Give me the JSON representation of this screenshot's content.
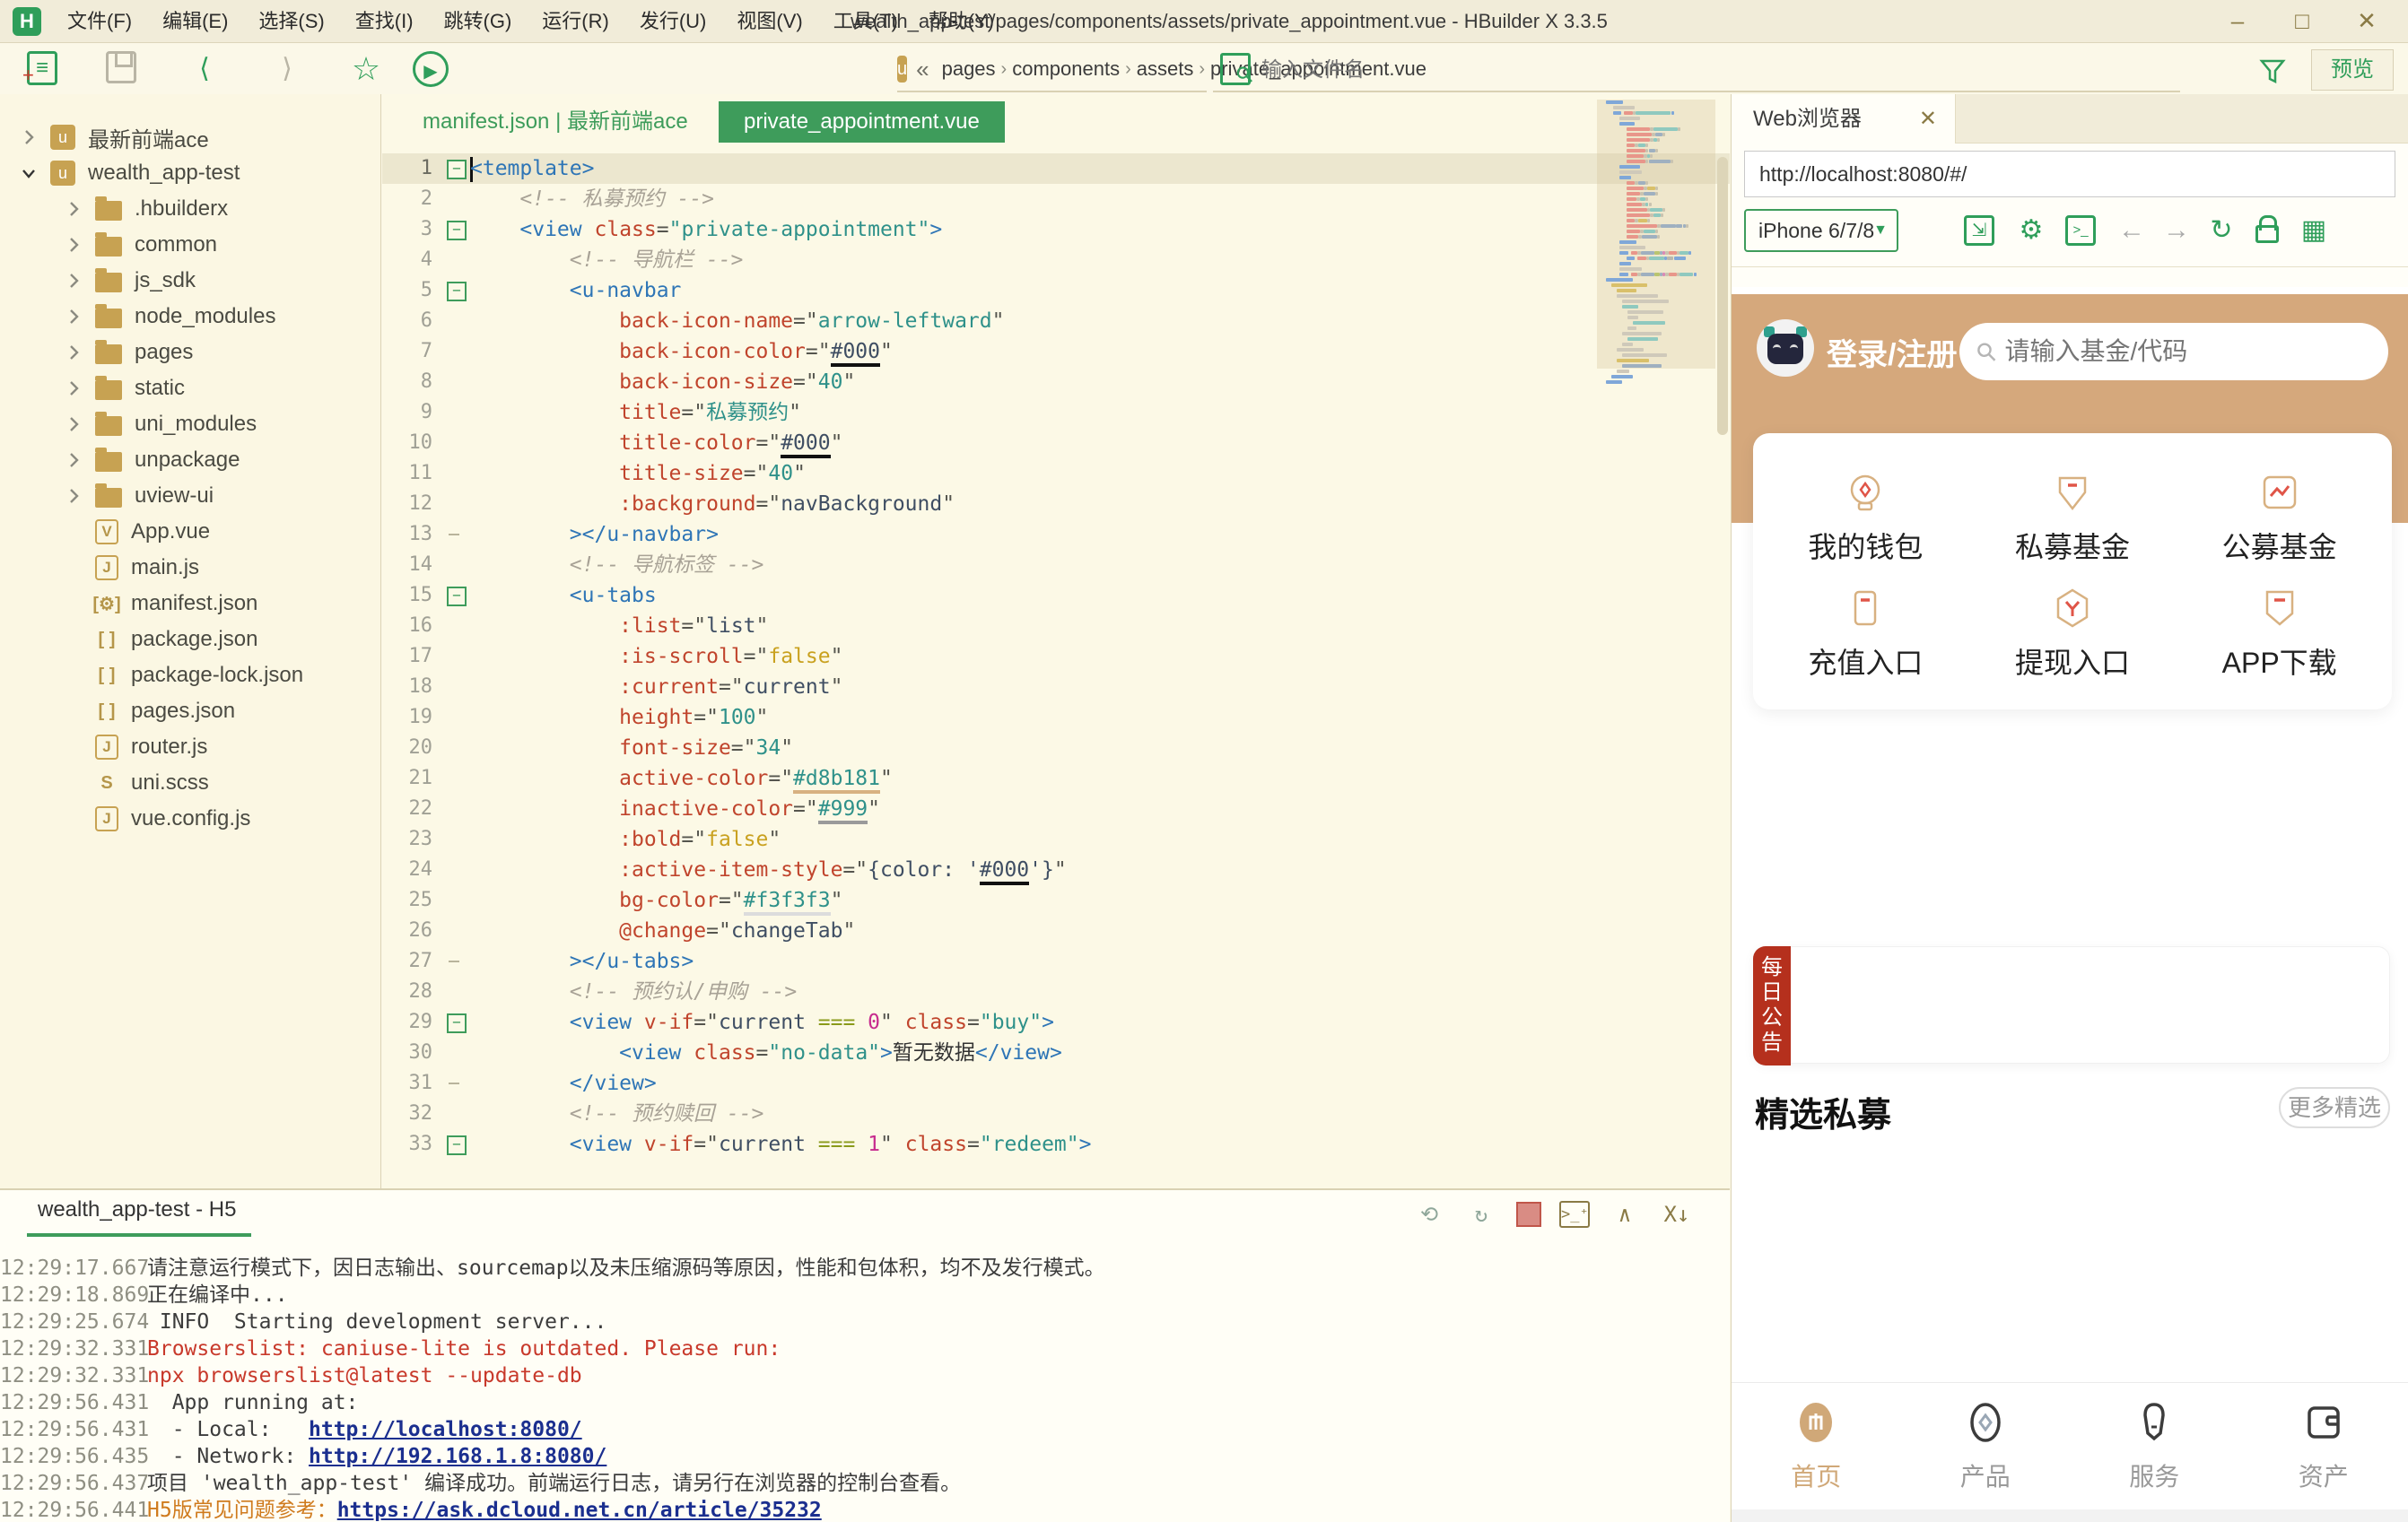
{
  "titlebar": {
    "title": "wealth_app-test/pages/components/assets/private_appointment.vue - HBuilder X 3.3.5",
    "logo": "H",
    "menu": [
      "文件(F)",
      "编辑(E)",
      "选择(S)",
      "查找(I)",
      "跳转(G)",
      "运行(R)",
      "发行(U)",
      "视图(V)",
      "工具(T)",
      "帮助(Y)"
    ],
    "controls": {
      "minimize": "–",
      "maximize": "□",
      "close": "✕"
    }
  },
  "toolbar": {
    "breadcrumb_prefix": "«",
    "breadcrumb": [
      "pages",
      "components",
      "assets",
      "private_appointment.vue"
    ],
    "search_placeholder": "输入文件名",
    "preview_label": "预览"
  },
  "sidebar": {
    "items": [
      {
        "depth": 0,
        "chevron": "right",
        "icon": "uni",
        "label": "最新前端ace"
      },
      {
        "depth": 0,
        "chevron": "down",
        "icon": "uni",
        "label": "wealth_app-test"
      },
      {
        "depth": 1,
        "chevron": "right",
        "icon": "folder",
        "label": ".hbuilderx"
      },
      {
        "depth": 1,
        "chevron": "right",
        "icon": "folder",
        "label": "common"
      },
      {
        "depth": 1,
        "chevron": "right",
        "icon": "folder",
        "label": "js_sdk"
      },
      {
        "depth": 1,
        "chevron": "right",
        "icon": "folder",
        "label": "node_modules"
      },
      {
        "depth": 1,
        "chevron": "right",
        "icon": "folder",
        "label": "pages"
      },
      {
        "depth": 1,
        "chevron": "right",
        "icon": "folder",
        "label": "static"
      },
      {
        "depth": 1,
        "chevron": "right",
        "icon": "folder",
        "label": "uni_modules"
      },
      {
        "depth": 1,
        "chevron": "right",
        "icon": "folder",
        "label": "unpackage"
      },
      {
        "depth": 1,
        "chevron": "right",
        "icon": "folder",
        "label": "uview-ui"
      },
      {
        "depth": 1,
        "chevron": "none",
        "icon": "vue",
        "label": "App.vue"
      },
      {
        "depth": 1,
        "chevron": "none",
        "icon": "js",
        "label": "main.js"
      },
      {
        "depth": 1,
        "chevron": "none",
        "icon": "manifest",
        "label": "manifest.json"
      },
      {
        "depth": 1,
        "chevron": "none",
        "icon": "json",
        "label": "package.json"
      },
      {
        "depth": 1,
        "chevron": "none",
        "icon": "json",
        "label": "package-lock.json"
      },
      {
        "depth": 1,
        "chevron": "none",
        "icon": "json",
        "label": "pages.json"
      },
      {
        "depth": 1,
        "chevron": "none",
        "icon": "js",
        "label": "router.js"
      },
      {
        "depth": 1,
        "chevron": "none",
        "icon": "scss",
        "label": "uni.scss"
      },
      {
        "depth": 1,
        "chevron": "none",
        "icon": "js",
        "label": "vue.config.js"
      }
    ]
  },
  "editor": {
    "inactive_tab": "manifest.json | 最新前端ace",
    "active_tab": "private_appointment.vue",
    "lines": [
      {
        "n": 1,
        "fold": "m",
        "hl": true,
        "tokens": [
          [
            "tag",
            "<template>"
          ]
        ]
      },
      {
        "n": 2,
        "fold": "",
        "tokens": [
          [
            "eq",
            "    "
          ],
          [
            "cmt",
            "<!-- 私募预约 -->"
          ]
        ]
      },
      {
        "n": 3,
        "fold": "m",
        "tokens": [
          [
            "eq",
            "    "
          ],
          [
            "tag",
            "<view"
          ],
          [
            "eq",
            " "
          ],
          [
            "attr",
            "class"
          ],
          [
            "eq",
            "="
          ],
          [
            "str",
            "\"private-appointment\""
          ],
          [
            "tag",
            ">"
          ]
        ]
      },
      {
        "n": 4,
        "fold": "",
        "tokens": [
          [
            "eq",
            "        "
          ],
          [
            "cmt",
            "<!-- 导航栏 -->"
          ]
        ]
      },
      {
        "n": 5,
        "fold": "m",
        "tokens": [
          [
            "eq",
            "        "
          ],
          [
            "tag",
            "<u-navbar"
          ]
        ]
      },
      {
        "n": 6,
        "fold": "",
        "tokens": [
          [
            "eq",
            "            "
          ],
          [
            "attr",
            "back-icon-name"
          ],
          [
            "eq",
            "=\""
          ],
          [
            "str",
            "arrow-leftward"
          ],
          [
            "eq",
            "\""
          ]
        ]
      },
      {
        "n": 7,
        "fold": "",
        "tokens": [
          [
            "eq",
            "            "
          ],
          [
            "attr",
            "back-icon-color"
          ],
          [
            "eq",
            "=\""
          ],
          [
            "ub",
            "#000"
          ],
          [
            "eq",
            "\""
          ]
        ]
      },
      {
        "n": 8,
        "fold": "",
        "tokens": [
          [
            "eq",
            "            "
          ],
          [
            "attr",
            "back-icon-size"
          ],
          [
            "eq",
            "=\""
          ],
          [
            "str",
            "40"
          ],
          [
            "eq",
            "\""
          ]
        ]
      },
      {
        "n": 9,
        "fold": "",
        "tokens": [
          [
            "eq",
            "            "
          ],
          [
            "attr",
            "title"
          ],
          [
            "eq",
            "=\""
          ],
          [
            "str",
            "私募预约"
          ],
          [
            "eq",
            "\""
          ]
        ]
      },
      {
        "n": 10,
        "fold": "",
        "tokens": [
          [
            "eq",
            "            "
          ],
          [
            "attr",
            "title-color"
          ],
          [
            "eq",
            "=\""
          ],
          [
            "ub",
            "#000"
          ],
          [
            "eq",
            "\""
          ]
        ]
      },
      {
        "n": 11,
        "fold": "",
        "tokens": [
          [
            "eq",
            "            "
          ],
          [
            "attr",
            "title-size"
          ],
          [
            "eq",
            "=\""
          ],
          [
            "str",
            "40"
          ],
          [
            "eq",
            "\""
          ]
        ]
      },
      {
        "n": 12,
        "fold": "",
        "tokens": [
          [
            "eq",
            "            "
          ],
          [
            "attr",
            ":background"
          ],
          [
            "eq",
            "=\""
          ],
          [
            "expr",
            "navBackground"
          ],
          [
            "eq",
            "\""
          ]
        ]
      },
      {
        "n": 13,
        "fold": "e",
        "tokens": [
          [
            "eq",
            "        "
          ],
          [
            "tag",
            "></u-navbar>"
          ]
        ]
      },
      {
        "n": 14,
        "fold": "",
        "tokens": [
          [
            "eq",
            "        "
          ],
          [
            "cmt",
            "<!-- 导航标签 -->"
          ]
        ]
      },
      {
        "n": 15,
        "fold": "m",
        "tokens": [
          [
            "eq",
            "        "
          ],
          [
            "tag",
            "<u-tabs"
          ]
        ]
      },
      {
        "n": 16,
        "fold": "",
        "tokens": [
          [
            "eq",
            "            "
          ],
          [
            "attr",
            ":list"
          ],
          [
            "eq",
            "=\""
          ],
          [
            "expr",
            "list"
          ],
          [
            "eq",
            "\""
          ]
        ]
      },
      {
        "n": 17,
        "fold": "",
        "tokens": [
          [
            "eq",
            "            "
          ],
          [
            "attr",
            ":is-scroll"
          ],
          [
            "eq",
            "=\""
          ],
          [
            "kwy",
            "false"
          ],
          [
            "eq",
            "\""
          ]
        ]
      },
      {
        "n": 18,
        "fold": "",
        "tokens": [
          [
            "eq",
            "            "
          ],
          [
            "attr",
            ":current"
          ],
          [
            "eq",
            "=\""
          ],
          [
            "expr",
            "current"
          ],
          [
            "eq",
            "\""
          ]
        ]
      },
      {
        "n": 19,
        "fold": "",
        "tokens": [
          [
            "eq",
            "            "
          ],
          [
            "attr",
            "height"
          ],
          [
            "eq",
            "=\""
          ],
          [
            "str",
            "100"
          ],
          [
            "eq",
            "\""
          ]
        ]
      },
      {
        "n": 20,
        "fold": "",
        "tokens": [
          [
            "eq",
            "            "
          ],
          [
            "attr",
            "font-size"
          ],
          [
            "eq",
            "=\""
          ],
          [
            "str",
            "34"
          ],
          [
            "eq",
            "\""
          ]
        ]
      },
      {
        "n": 21,
        "fold": "",
        "tokens": [
          [
            "eq",
            "            "
          ],
          [
            "attr",
            "active-color"
          ],
          [
            "eq",
            "=\""
          ],
          [
            "ut",
            "#d8b181"
          ],
          [
            "eq",
            "\""
          ]
        ]
      },
      {
        "n": 22,
        "fold": "",
        "tokens": [
          [
            "eq",
            "            "
          ],
          [
            "attr",
            "inactive-color"
          ],
          [
            "eq",
            "=\""
          ],
          [
            "ug",
            "#999"
          ],
          [
            "eq",
            "\""
          ]
        ]
      },
      {
        "n": 23,
        "fold": "",
        "tokens": [
          [
            "eq",
            "            "
          ],
          [
            "attr",
            ":bold"
          ],
          [
            "eq",
            "=\""
          ],
          [
            "kwy",
            "false"
          ],
          [
            "eq",
            "\""
          ]
        ]
      },
      {
        "n": 24,
        "fold": "",
        "tokens": [
          [
            "eq",
            "            "
          ],
          [
            "attr",
            ":active-item-style"
          ],
          [
            "eq",
            "=\""
          ],
          [
            "expr",
            "{color: '"
          ],
          [
            "ub",
            "#000"
          ],
          [
            "expr",
            "'}"
          ],
          [
            "eq",
            "\""
          ]
        ]
      },
      {
        "n": 25,
        "fold": "",
        "tokens": [
          [
            "eq",
            "            "
          ],
          [
            "attr",
            "bg-color"
          ],
          [
            "eq",
            "=\""
          ],
          [
            "ul",
            "#f3f3f3"
          ],
          [
            "eq",
            "\""
          ]
        ]
      },
      {
        "n": 26,
        "fold": "",
        "tokens": [
          [
            "eq",
            "            "
          ],
          [
            "attr",
            "@change"
          ],
          [
            "eq",
            "=\""
          ],
          [
            "expr",
            "changeTab"
          ],
          [
            "eq",
            "\""
          ]
        ]
      },
      {
        "n": 27,
        "fold": "e",
        "tokens": [
          [
            "eq",
            "        "
          ],
          [
            "tag",
            "></u-tabs>"
          ]
        ]
      },
      {
        "n": 28,
        "fold": "",
        "tokens": [
          [
            "eq",
            "        "
          ],
          [
            "cmt",
            "<!-- 预约认/申购 -->"
          ]
        ]
      },
      {
        "n": 29,
        "fold": "m",
        "tokens": [
          [
            "eq",
            "        "
          ],
          [
            "tag",
            "<view"
          ],
          [
            "eq",
            " "
          ],
          [
            "attr",
            "v-if"
          ],
          [
            "eq",
            "=\""
          ],
          [
            "expr",
            "current "
          ],
          [
            "op",
            "==="
          ],
          [
            "expr",
            " "
          ],
          [
            "num",
            "0"
          ],
          [
            "eq",
            "\" "
          ],
          [
            "attr",
            "class"
          ],
          [
            "eq",
            "="
          ],
          [
            "str",
            "\"buy\""
          ],
          [
            "tag",
            ">"
          ]
        ]
      },
      {
        "n": 30,
        "fold": "",
        "tokens": [
          [
            "eq",
            "            "
          ],
          [
            "tag",
            "<view"
          ],
          [
            "eq",
            " "
          ],
          [
            "attr",
            "class"
          ],
          [
            "eq",
            "="
          ],
          [
            "str",
            "\"no-data\""
          ],
          [
            "tag",
            ">"
          ],
          [
            "txt",
            "暂无数据"
          ],
          [
            "tag",
            "</view>"
          ]
        ]
      },
      {
        "n": 31,
        "fold": "e",
        "tokens": [
          [
            "eq",
            "        "
          ],
          [
            "tag",
            "</view>"
          ]
        ]
      },
      {
        "n": 32,
        "fold": "",
        "tokens": [
          [
            "eq",
            "        "
          ],
          [
            "cmt",
            "<!-- 预约赎回 -->"
          ]
        ]
      },
      {
        "n": 33,
        "fold": "m",
        "tokens": [
          [
            "eq",
            "        "
          ],
          [
            "tag",
            "<view"
          ],
          [
            "eq",
            " "
          ],
          [
            "attr",
            "v-if"
          ],
          [
            "eq",
            "=\""
          ],
          [
            "expr",
            "current "
          ],
          [
            "op",
            "==="
          ],
          [
            "expr",
            " "
          ],
          [
            "num",
            "1"
          ],
          [
            "eq",
            "\" "
          ],
          [
            "attr",
            "class"
          ],
          [
            "eq",
            "="
          ],
          [
            "str",
            "\"redeem\""
          ],
          [
            "tag",
            ">"
          ]
        ]
      }
    ]
  },
  "browser": {
    "tab": "Web浏览器",
    "tab_close": "✕",
    "url": "http://localhost:8080/#/",
    "device": "iPhone 6/7/8",
    "phone": {
      "login": "登录/注册",
      "search_placeholder": "请输入基金/代码",
      "grid": [
        {
          "label": "我的钱包",
          "icon": "wallet"
        },
        {
          "label": "私募基金",
          "icon": "shield-drop"
        },
        {
          "label": "公募基金",
          "icon": "chart"
        },
        {
          "label": "充值入口",
          "icon": "card"
        },
        {
          "label": "提现入口",
          "icon": "hexagon"
        },
        {
          "label": "APP下载",
          "icon": "badge-download"
        }
      ],
      "notice_tag": "每日公告",
      "section_title": "精选私募",
      "section_more": "更多精选",
      "tabbar": [
        {
          "label": "首页",
          "icon": "home",
          "active": true
        },
        {
          "label": "产品",
          "icon": "product",
          "active": false
        },
        {
          "label": "服务",
          "icon": "service",
          "active": false
        },
        {
          "label": "资产",
          "icon": "asset",
          "active": false
        }
      ]
    }
  },
  "console": {
    "tab": "wealth_app-test - H5",
    "logs": [
      {
        "time": "12:29:17.667",
        "segments": [
          {
            "type": "plain",
            "text": "请注意运行模式下，因日志输出、sourcemap以及未压缩源码等原因，性能和包体积，均不及发行模式。"
          }
        ]
      },
      {
        "time": "12:29:18.869",
        "segments": [
          {
            "type": "plain",
            "text": "正在编译中..."
          }
        ]
      },
      {
        "time": "12:29:25.674",
        "segments": [
          {
            "type": "plain",
            "text": " INFO  Starting development server..."
          }
        ]
      },
      {
        "time": "12:29:32.331",
        "segments": [
          {
            "type": "error",
            "text": "Browserslist: caniuse-lite is outdated. Please run:"
          }
        ]
      },
      {
        "time": "12:29:32.331",
        "segments": [
          {
            "type": "error",
            "text": "npx browserslist@latest --update-db"
          }
        ]
      },
      {
        "time": "12:29:56.431",
        "segments": [
          {
            "type": "plain",
            "text": "  App running at:"
          }
        ]
      },
      {
        "time": "12:29:56.431",
        "segments": [
          {
            "type": "plain",
            "text": "  - Local:   "
          },
          {
            "type": "link",
            "text": "http://localhost:8080/"
          }
        ]
      },
      {
        "time": "12:29:56.435",
        "segments": [
          {
            "type": "plain",
            "text": "  - Network: "
          },
          {
            "type": "link",
            "text": "http://192.168.1.8:8080/"
          }
        ]
      },
      {
        "time": "12:29:56.437",
        "segments": [
          {
            "type": "plain",
            "text": "项目 'wealth_app-test' 编译成功。前端运行日志，请另行在浏览器的控制台查看。"
          }
        ]
      },
      {
        "time": "12:29:56.441",
        "segments": [
          {
            "type": "warn",
            "text": "H5版常见问题参考："
          },
          {
            "type": "link",
            "text": "https://ask.dcloud.net.cn/article/35232"
          }
        ]
      }
    ]
  }
}
